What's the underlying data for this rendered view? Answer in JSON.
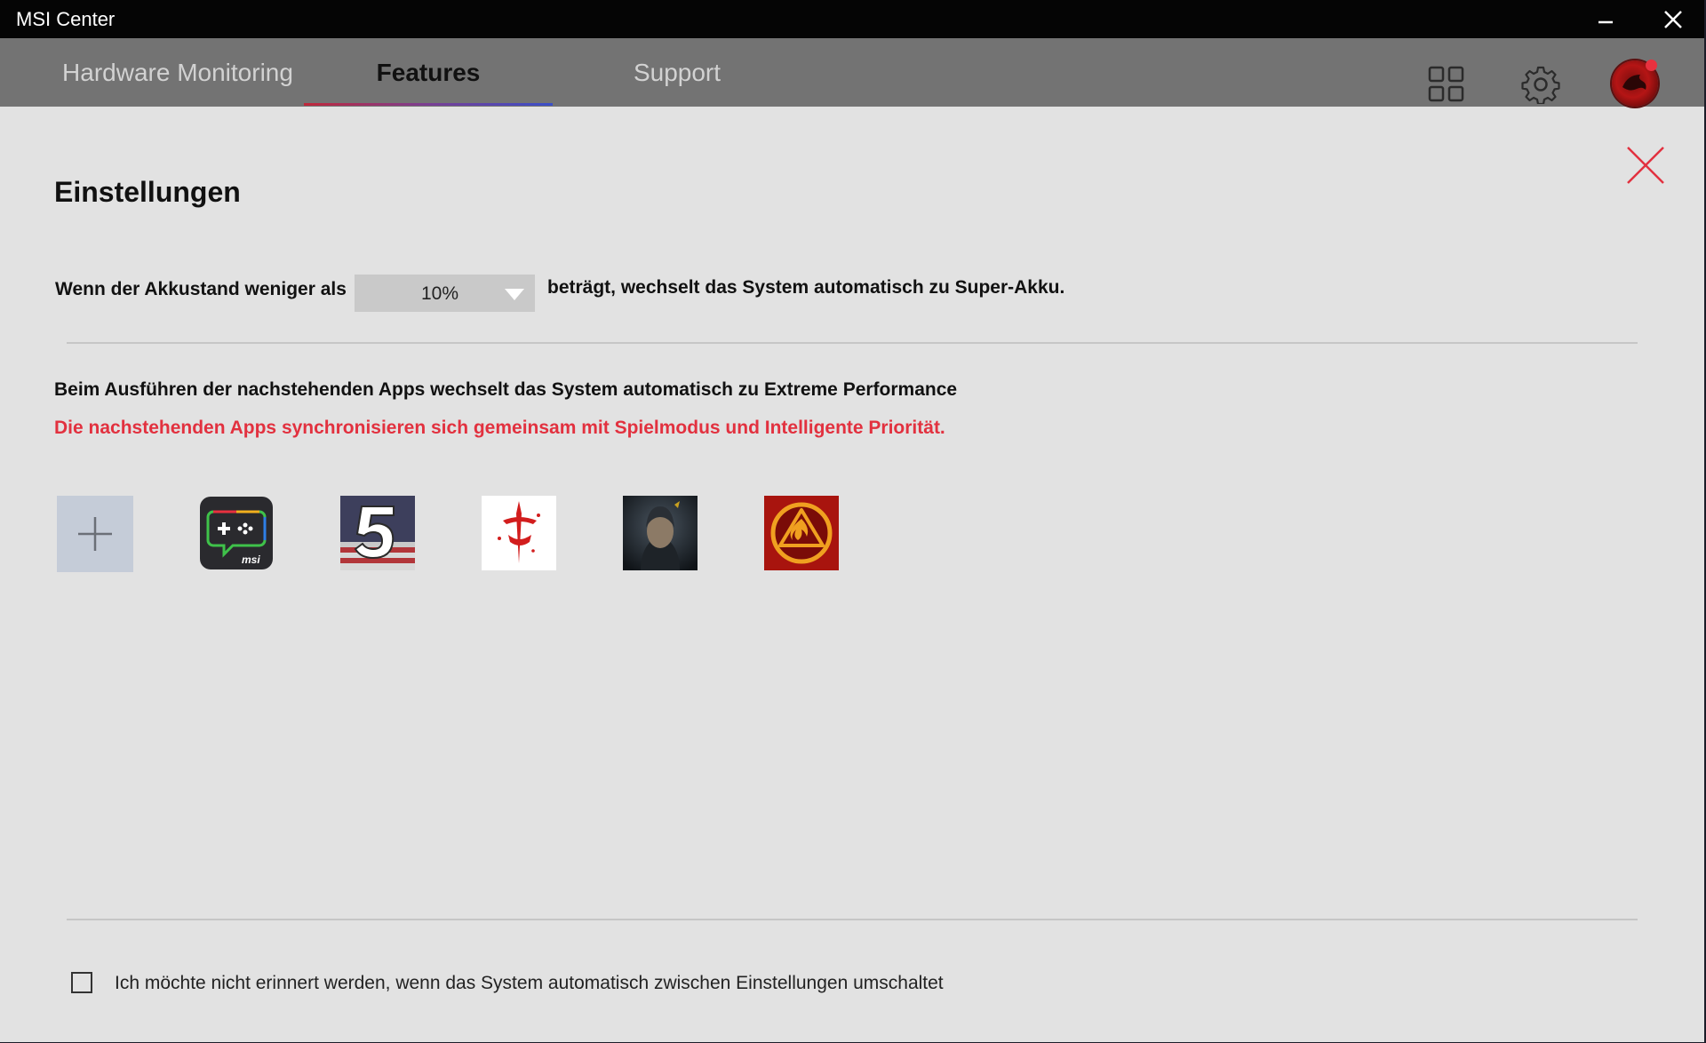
{
  "window": {
    "title": "MSI Center"
  },
  "tabs": [
    {
      "label": "Hardware Monitoring",
      "active": false
    },
    {
      "label": "Features",
      "active": true
    },
    {
      "label": "Support",
      "active": false
    }
  ],
  "top_icons": [
    "grid-icon",
    "gear-icon",
    "avatar"
  ],
  "panel": {
    "heading": "Einstellungen",
    "battery_rule": {
      "prefix": "Wenn der Akkustand weniger als",
      "selected_value": "10%",
      "suffix": "beträgt, wechselt das System automatisch zu Super-Akku."
    },
    "apps_section": {
      "title": "Beim Ausführen der nachstehenden Apps wechselt das System automatisch zu Extreme Performance",
      "note": "Die nachstehenden Apps synchronisieren sich gemeinsam mit Spielmodus und Intelligente Priorität.",
      "add_icon": "plus-icon",
      "apps": [
        {
          "icon": "msi-game-chat-icon"
        },
        {
          "icon": "number-five-flag-icon"
        },
        {
          "icon": "red-rune-icon"
        },
        {
          "icon": "hooded-figure-icon"
        },
        {
          "icon": "fire-emblem-icon"
        }
      ]
    },
    "reminder_checkbox": {
      "label": "Ich möchte nicht erinnert werden, wenn das System automatisch zwischen Einstellungen umschaltet",
      "checked": false
    }
  },
  "colors": {
    "accent_red": "#e2313f",
    "titlebar": "#050505",
    "tabbar": "#737373",
    "panel_bg": "#e2e2e2"
  }
}
